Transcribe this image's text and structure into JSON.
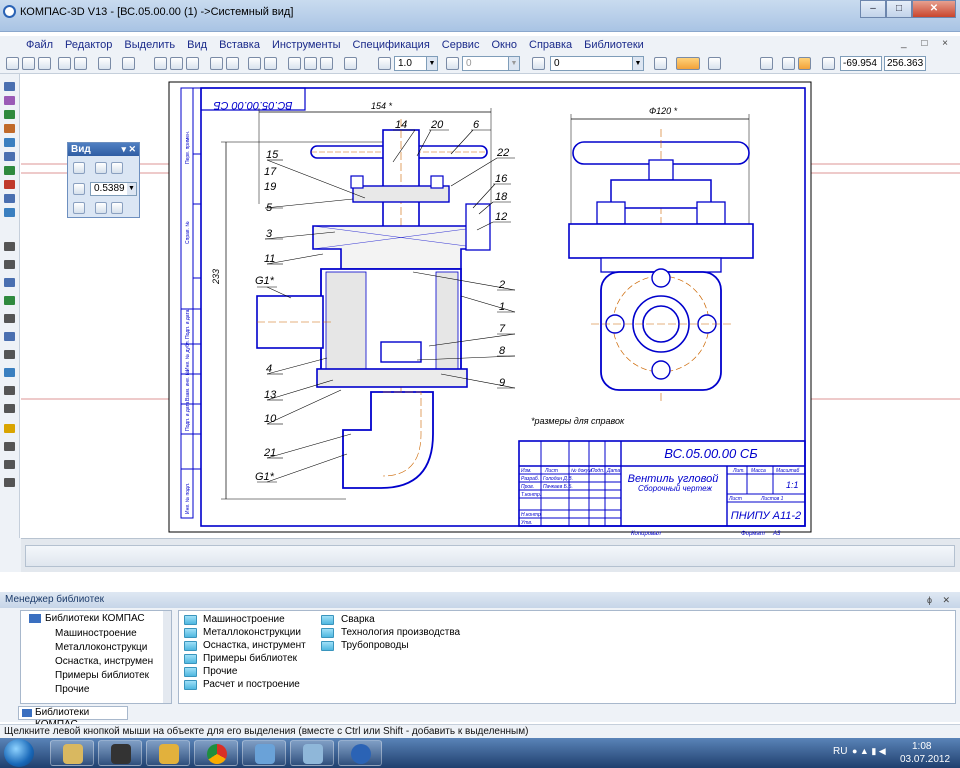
{
  "window": {
    "title": "КОМПАС-3D V13 - [ВС.05.00.00 (1) ->Системный вид]",
    "controls": [
      "–",
      "□",
      "✕"
    ]
  },
  "menu": [
    "Файл",
    "Редактор",
    "Выделить",
    "Вид",
    "Вставка",
    "Инструменты",
    "Спецификация",
    "Сервис",
    "Окно",
    "Справка",
    "Библиотеки"
  ],
  "toolbar": {
    "step_value": "1.0",
    "angle_value": "0",
    "layer_value": "0",
    "coord_x": "-69.954",
    "coord_y": "256.363"
  },
  "view_panel": {
    "title": "Вид",
    "zoom": "0.5389"
  },
  "drawing": {
    "stamp_rotated": "ВС.05.00.00 СБ",
    "dim_width": "154 *",
    "dim_height": "233",
    "dim_diameter": "Ф120 *",
    "thread_top": "G1*",
    "thread_bottom": "G1*",
    "note": "*размеры для справок",
    "part_labels": {
      "p1": "1",
      "p2": "2",
      "p3": "3",
      "p4": "4",
      "p5": "5",
      "p6": "6",
      "p7": "7",
      "p8": "8",
      "p9": "9",
      "p10": "10",
      "p11": "11",
      "p12": "12",
      "p13": "13",
      "p14": "14",
      "p15": "15",
      "p16": "16",
      "p17": "17",
      "p18": "18",
      "p19": "19",
      "p20": "20",
      "p21": "21",
      "p22": "22"
    },
    "title_block": {
      "designation": "ВС.05.00.00 СБ",
      "name": "Вентиль угловой",
      "subtitle": "Сборочный чертеж",
      "organization": "ПНИПУ А11-2",
      "col_lit": "Лит.",
      "col_mass": "Масса",
      "col_scale": "Масштаб",
      "scale": "1:1",
      "sheet": "Лист",
      "sheets": "Листов 1",
      "razrab": "Разраб.",
      "razrab_name": "Голодин Д.В.",
      "prov": "Пров.",
      "prov_name": "Пачкаев Б.Б.",
      "tkontr": "Т.контр.",
      "nkontr": "Н.контр.",
      "utv": "Утв.",
      "izm": "Изм.",
      "list": "Лист",
      "ndokum": "№ докум.",
      "podp": "Подп.",
      "data": "Дата",
      "copied": "Копировал",
      "format": "Формат",
      "format_value": "А3"
    },
    "side_labels": [
      "Перв. примен.",
      "Справ. №",
      "Подп. и дата",
      "Инв. № дубл.",
      "Взам. инв. №",
      "Подп. и дата",
      "Инв. № подл."
    ]
  },
  "library_manager": {
    "title": "Менеджер библиотек",
    "tree_root": "Библиотеки КОМПАС",
    "tree_items": [
      "Машиностроение",
      "Металлоконструкци",
      "Оснастка, инструмен",
      "Примеры библиотек",
      "Прочие"
    ],
    "folders_col1": [
      "Машиностроение",
      "Металлоконструкции",
      "Оснастка, инструмент",
      "Примеры библиотек",
      "Прочие",
      "Расчет и построение"
    ],
    "folders_col2": [
      "Сварка",
      "Технология производства",
      "Трубопроводы"
    ],
    "tab": "Библиотеки КОМПАС"
  },
  "status": "Щелкните левой кнопкой мыши на объекте для его выделения (вместе с Ctrl или Shift - добавить к выделенным)",
  "tray": {
    "lang": "RU",
    "time": "1:08",
    "date": "03.07.2012"
  }
}
